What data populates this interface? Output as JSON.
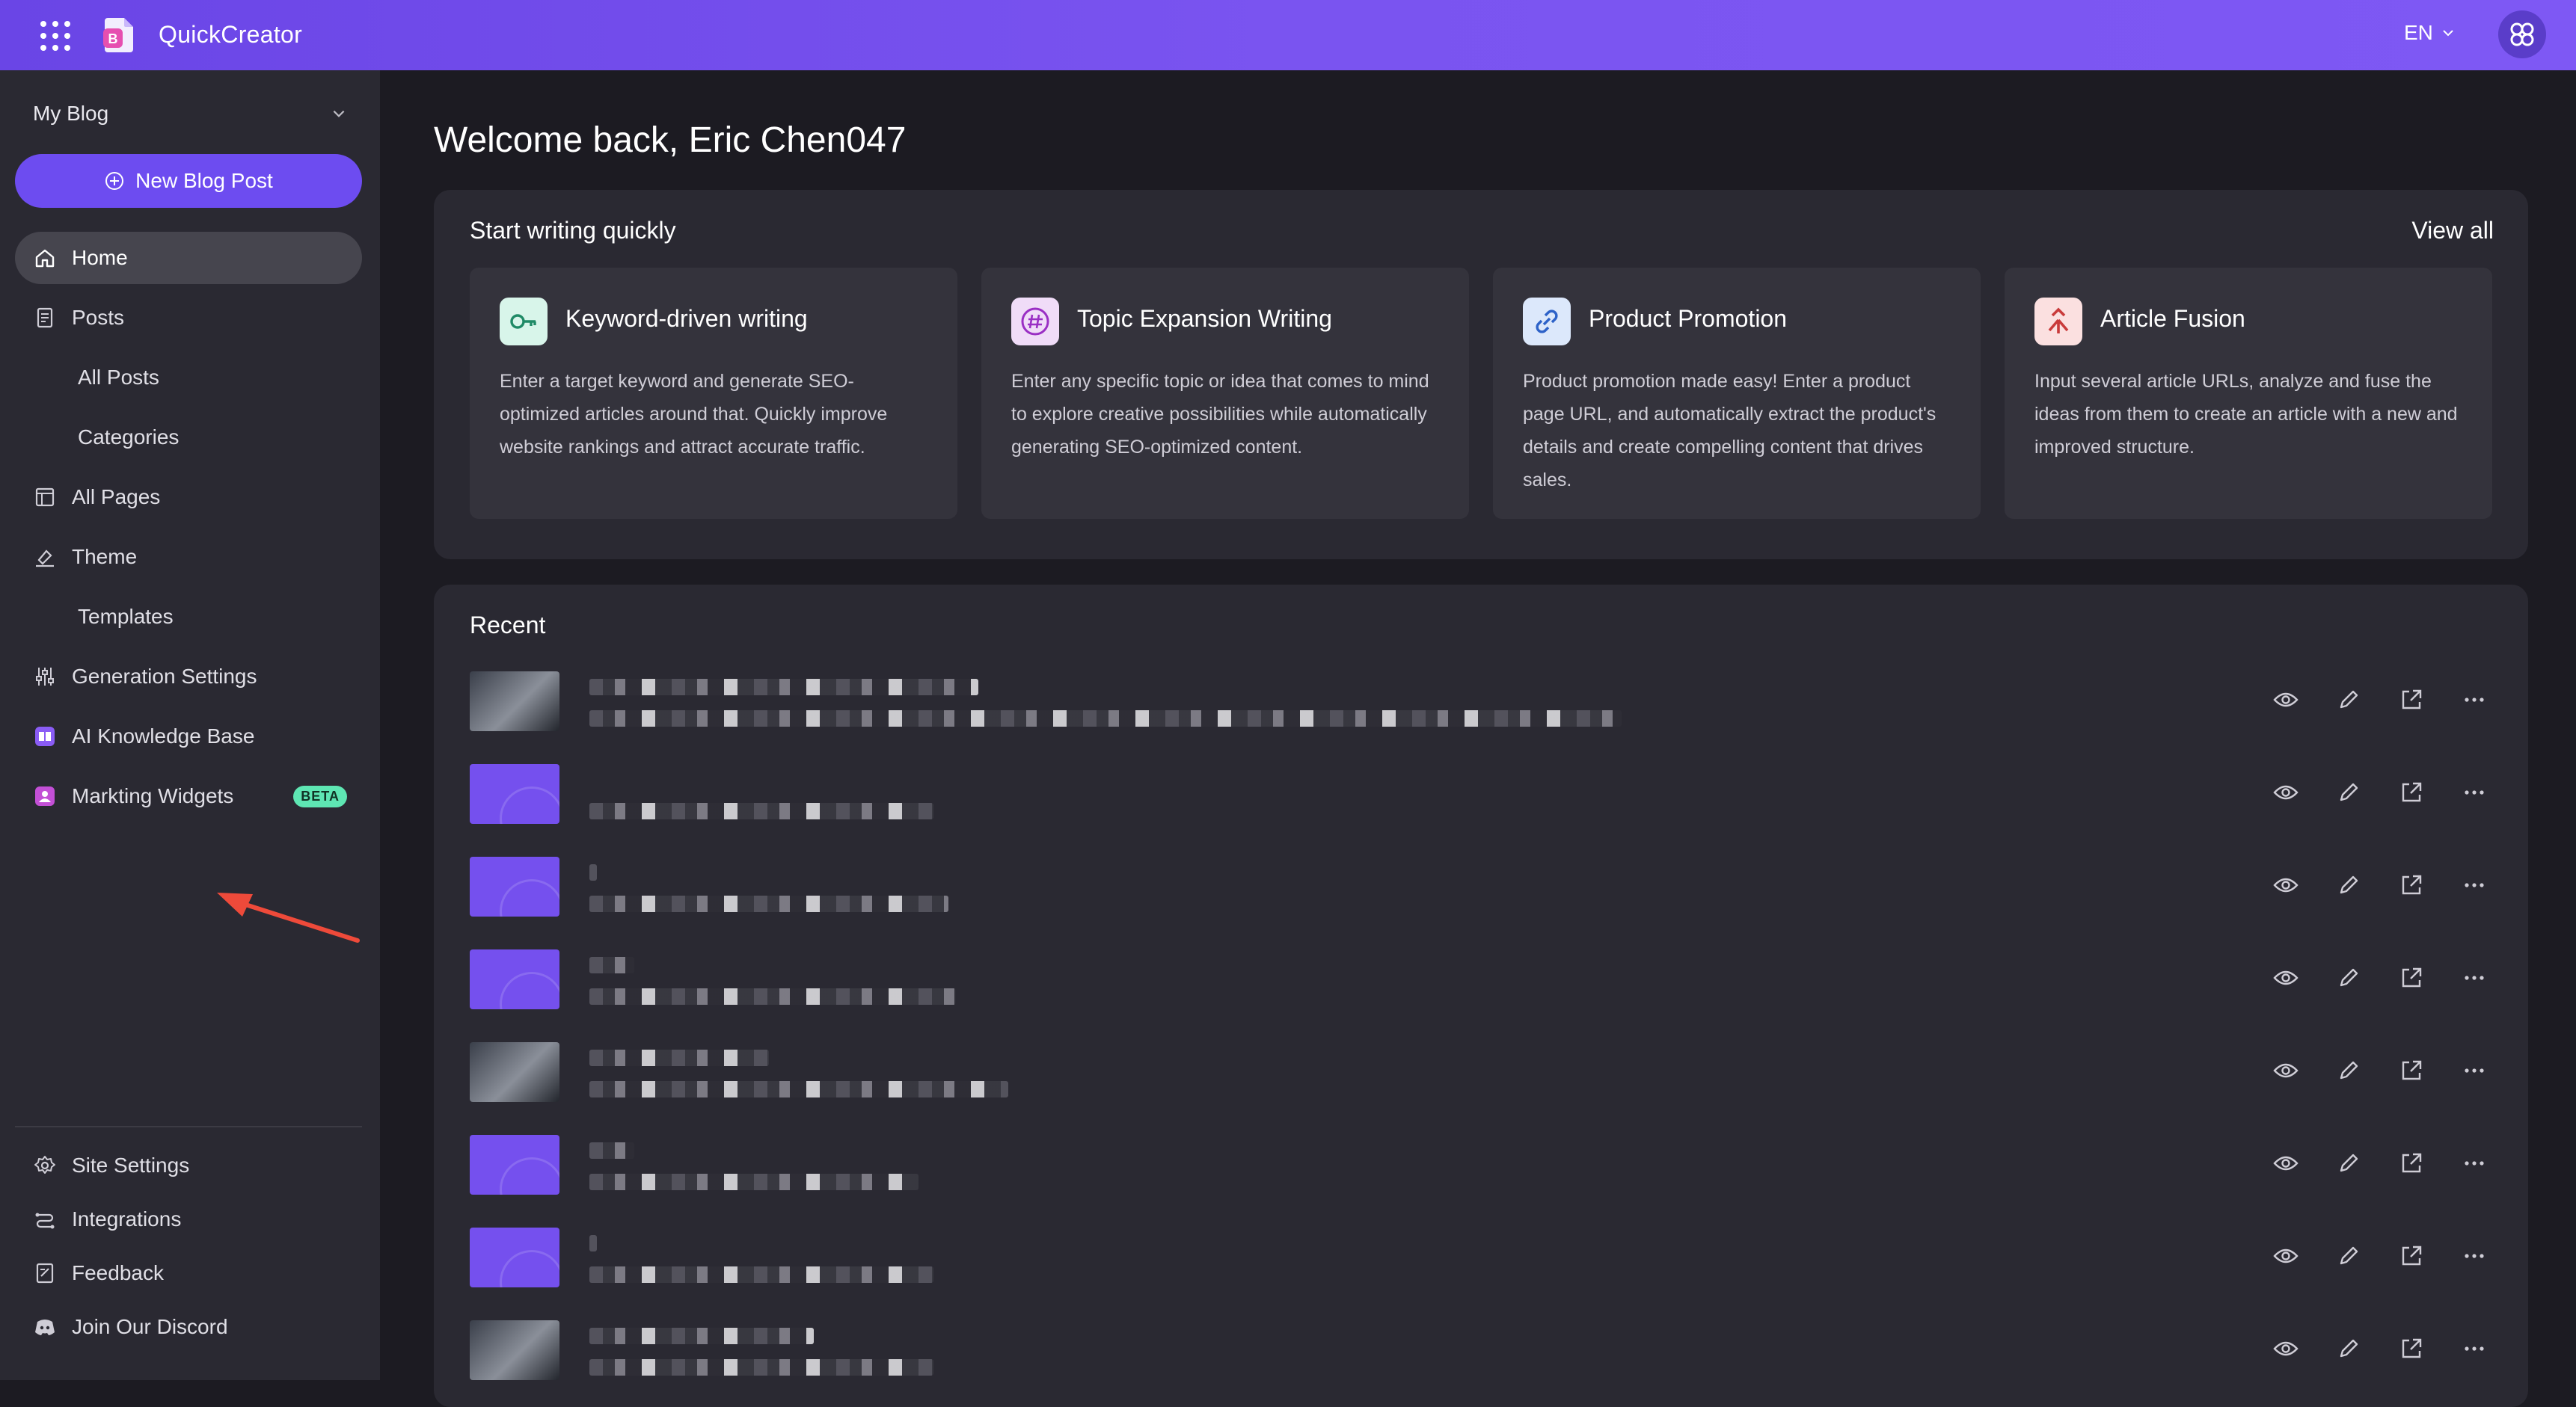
{
  "header": {
    "app_name": "QuickCreator",
    "language": "EN"
  },
  "sidebar": {
    "blog_selector": "My Blog",
    "new_post": "New Blog Post",
    "items": [
      {
        "label": "Home",
        "icon": "home-icon",
        "active": true
      },
      {
        "label": "Posts",
        "icon": "document-icon"
      },
      {
        "label": "All Posts"
      },
      {
        "label": "Categories"
      },
      {
        "label": "All Pages",
        "icon": "layout-icon"
      },
      {
        "label": "Theme",
        "icon": "brush-icon"
      },
      {
        "label": "Templates"
      },
      {
        "label": "Generation Settings",
        "icon": "sliders-icon"
      },
      {
        "label": "AI Knowledge Base",
        "icon": "book-icon"
      },
      {
        "label": "Markting Widgets",
        "icon": "widget-icon",
        "badge": "BETA"
      }
    ],
    "bottom_items": [
      {
        "label": "Site Settings",
        "icon": "gear-icon"
      },
      {
        "label": "Integrations",
        "icon": "integrations-icon"
      },
      {
        "label": "Feedback",
        "icon": "feedback-icon"
      },
      {
        "label": "Join Our Discord",
        "icon": "discord-icon"
      }
    ]
  },
  "main": {
    "welcome": "Welcome back, Eric Chen047",
    "quick": {
      "title": "Start writing quickly",
      "view_all": "View all",
      "cards": [
        {
          "title": "Keyword-driven writing",
          "desc": "Enter a target keyword and generate SEO-optimized articles around that. Quickly improve website rankings and attract accurate traffic.",
          "icon": "key-icon",
          "color": "#d8f5ea"
        },
        {
          "title": "Topic Expansion Writing",
          "desc": "Enter any specific topic or idea that comes to mind to explore creative possibilities while automatically generating SEO-optimized content.",
          "icon": "hashtag-icon",
          "color": "#f0dcf8"
        },
        {
          "title": "Product Promotion",
          "desc": "Product promotion made easy! Enter a product page URL, and automatically extract the product's details and create compelling content that drives sales.",
          "icon": "link-icon",
          "color": "#dce8fb"
        },
        {
          "title": "Article Fusion",
          "desc": "Input several article URLs, analyze and fuse the ideas from them to create an article with a new and improved structure.",
          "icon": "merge-icon",
          "color": "#fbe0e0"
        }
      ]
    },
    "recent": {
      "title": "Recent",
      "rows": [
        {
          "thumb": "photo"
        },
        {
          "thumb": "purple"
        },
        {
          "thumb": "purple"
        },
        {
          "thumb": "purple"
        },
        {
          "thumb": "photo"
        },
        {
          "thumb": "purple"
        },
        {
          "thumb": "purple"
        },
        {
          "thumb": "photo"
        }
      ]
    }
  }
}
